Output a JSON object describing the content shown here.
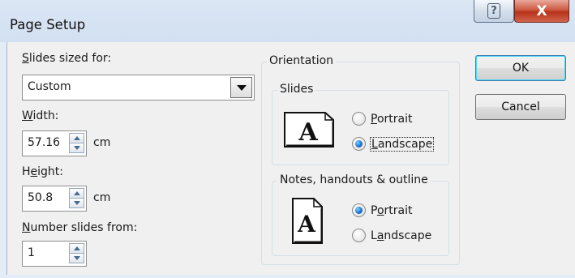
{
  "window": {
    "title": "Page Setup",
    "help_glyph": "?",
    "close_glyph": "X"
  },
  "slides_sized_for": {
    "label_accel": "S",
    "label_rest": "lides sized for:",
    "value": "Custom"
  },
  "width": {
    "label_accel": "W",
    "label_rest": "idth:",
    "value": "57.16",
    "unit": "cm"
  },
  "height": {
    "label_pre": "H",
    "label_accel": "e",
    "label_rest": "ight:",
    "value": "50.8",
    "unit": "cm"
  },
  "number_from": {
    "label_accel": "N",
    "label_rest": "umber slides from:",
    "value": "1"
  },
  "orientation": {
    "title": "Orientation",
    "slides": {
      "title": "Slides",
      "portrait_accel": "P",
      "portrait_rest": "ortrait",
      "landscape_accel": "L",
      "landscape_rest": "andscape",
      "selected": "landscape",
      "glyph": "A"
    },
    "notes": {
      "title": "Notes, handouts & outline",
      "portrait_pre": "P",
      "portrait_accel": "o",
      "portrait_rest": "rtrait",
      "landscape_pre": "L",
      "landscape_accel": "a",
      "landscape_rest": "ndscape",
      "selected": "portrait",
      "glyph": "A"
    }
  },
  "buttons": {
    "ok": "OK",
    "cancel": "Cancel"
  },
  "colors": {
    "titlebar": "#d2e0f1",
    "client": "#f0f0f0",
    "close_button": "#c9462c",
    "radio_selected": "#1168c8"
  },
  "icons": {
    "help": "help-icon",
    "close": "close-icon",
    "dropdown": "chevron-down-icon",
    "spin_up": "spin-up-icon",
    "spin_down": "spin-down-icon",
    "slide_landscape": "landscape-page-icon",
    "slide_portrait": "portrait-page-icon"
  }
}
